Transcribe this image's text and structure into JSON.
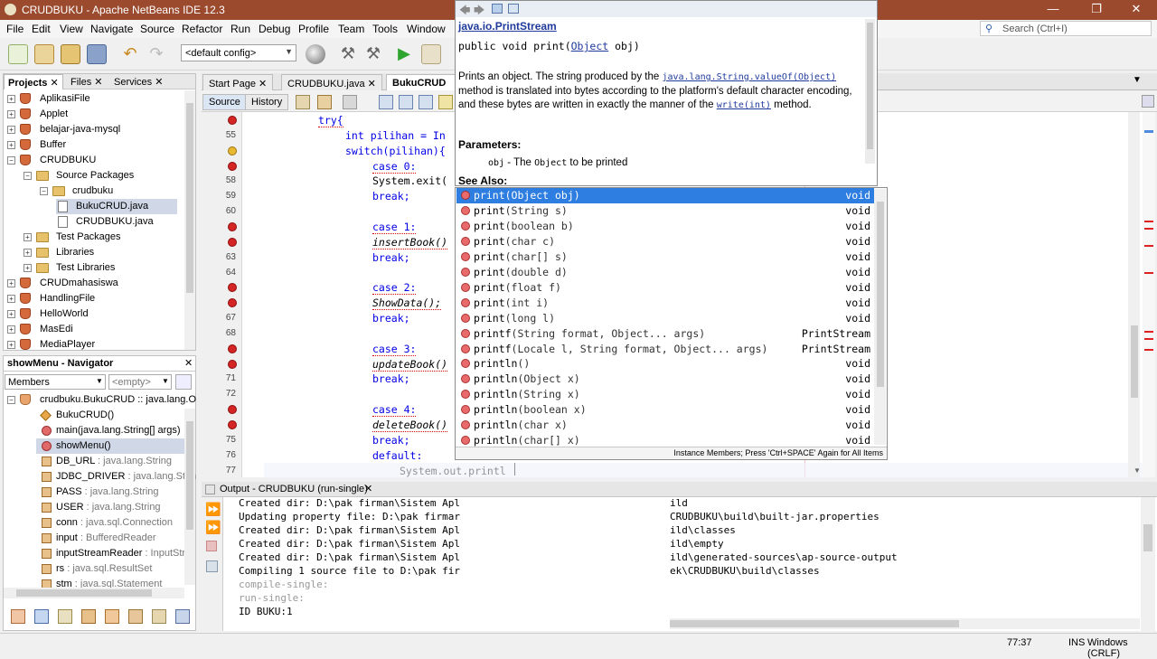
{
  "window": {
    "title": "CRUDBUKU - Apache NetBeans IDE 12.3",
    "min": "—",
    "max": "❐",
    "close": "✕"
  },
  "menu": [
    "File",
    "Edit",
    "View",
    "Navigate",
    "Source",
    "Refactor",
    "Run",
    "Debug",
    "Profile",
    "Team",
    "Tools",
    "Window"
  ],
  "search": {
    "placeholder": "Search (Ctrl+I)"
  },
  "toolbar": {
    "config": "<default config>"
  },
  "projects_panel": {
    "tabs": [
      "Projects",
      "Files",
      "Services"
    ],
    "items": [
      {
        "label": "AplikasiFile",
        "type": "project",
        "indent": 0
      },
      {
        "label": "Applet",
        "type": "project",
        "indent": 0
      },
      {
        "label": "belajar-java-mysql",
        "type": "project",
        "indent": 0
      },
      {
        "label": "Buffer",
        "type": "project",
        "indent": 0
      },
      {
        "label": "CRUDBUKU",
        "type": "project",
        "indent": 0
      },
      {
        "label": "Source Packages",
        "type": "folder",
        "indent": 1
      },
      {
        "label": "crudbuku",
        "type": "folder",
        "indent": 2
      },
      {
        "label": "BukuCRUD.java",
        "type": "file",
        "indent": 3,
        "selected": true
      },
      {
        "label": "CRUDBUKU.java",
        "type": "file",
        "indent": 3
      },
      {
        "label": "Test Packages",
        "type": "folder",
        "indent": 1
      },
      {
        "label": "Libraries",
        "type": "folder",
        "indent": 1
      },
      {
        "label": "Test Libraries",
        "type": "folder",
        "indent": 1
      },
      {
        "label": "CRUDmahasiswa",
        "type": "project",
        "indent": 0
      },
      {
        "label": "HandlingFile",
        "type": "project",
        "indent": 0
      },
      {
        "label": "HelloWorld",
        "type": "project",
        "indent": 0
      },
      {
        "label": "MasEdi",
        "type": "project",
        "indent": 0
      },
      {
        "label": "MediaPlayer",
        "type": "project",
        "indent": 0
      }
    ]
  },
  "navigator": {
    "title": "showMenu - Navigator",
    "members_label": "Members",
    "filter": "<empty>",
    "root": "crudbuku.BukuCRUD :: java.lang.O",
    "items": [
      {
        "label": "BukuCRUD()",
        "type": "",
        "kind": "ctor"
      },
      {
        "label": "main(java.lang.String[] args)",
        "type": "",
        "kind": "method"
      },
      {
        "label": "showMenu()",
        "type": "",
        "kind": "method",
        "selected": true
      },
      {
        "label": "DB_URL",
        "type": " : java.lang.String",
        "kind": "field"
      },
      {
        "label": "JDBC_DRIVER",
        "type": " : java.lang.Strin",
        "kind": "field"
      },
      {
        "label": "PASS",
        "type": " : java.lang.String",
        "kind": "field"
      },
      {
        "label": "USER",
        "type": " : java.lang.String",
        "kind": "field"
      },
      {
        "label": "conn",
        "type": " : java.sql.Connection",
        "kind": "field"
      },
      {
        "label": "input",
        "type": " : BufferedReader",
        "kind": "field"
      },
      {
        "label": "inputStreamReader",
        "type": " : InputStre",
        "kind": "field"
      },
      {
        "label": "rs",
        "type": " : java.sql.ResultSet",
        "kind": "field"
      },
      {
        "label": "stm",
        "type": " : java.sql.Statement",
        "kind": "field"
      }
    ]
  },
  "editor": {
    "tabs": [
      "Start Page",
      "CRUDBUKU.java",
      "BukuCRUD"
    ],
    "source_tab": "Source",
    "history_tab": "History",
    "lines": [
      {
        "n": "",
        "text": "try{",
        "indent": 84,
        "marker": "err",
        "kw": true
      },
      {
        "n": "55",
        "text": "int pilihan = In",
        "indent": 114,
        "marker": "",
        "kw": true
      },
      {
        "n": "",
        "text": "switch(pilihan){",
        "indent": 114,
        "marker": "warn",
        "kw": true
      },
      {
        "n": "",
        "text": "case 0:",
        "indent": 144,
        "marker": "err",
        "kw": true
      },
      {
        "n": "58",
        "text": "System.exit(",
        "indent": 144,
        "marker": ""
      },
      {
        "n": "59",
        "text": "break;",
        "indent": 144,
        "marker": "",
        "kw": true
      },
      {
        "n": "60",
        "text": "",
        "indent": 144,
        "marker": ""
      },
      {
        "n": "",
        "text": "case 1:",
        "indent": 144,
        "marker": "err",
        "kw": true
      },
      {
        "n": "",
        "text": "insertBook()",
        "indent": 144,
        "marker": "err",
        "it": true
      },
      {
        "n": "63",
        "text": "break;",
        "indent": 144,
        "marker": "",
        "kw": true
      },
      {
        "n": "64",
        "text": "",
        "indent": 144,
        "marker": ""
      },
      {
        "n": "",
        "text": "case 2:",
        "indent": 144,
        "marker": "err",
        "kw": true
      },
      {
        "n": "",
        "text": "ShowData();",
        "indent": 144,
        "marker": "err",
        "it": true
      },
      {
        "n": "67",
        "text": "break;",
        "indent": 144,
        "marker": "",
        "kw": true
      },
      {
        "n": "68",
        "text": "",
        "indent": 144,
        "marker": ""
      },
      {
        "n": "",
        "text": "case 3:",
        "indent": 144,
        "marker": "err",
        "kw": true
      },
      {
        "n": "",
        "text": "updateBook()",
        "indent": 144,
        "marker": "err",
        "it": true
      },
      {
        "n": "71",
        "text": "break;",
        "indent": 144,
        "marker": "",
        "kw": true
      },
      {
        "n": "72",
        "text": "",
        "indent": 144,
        "marker": ""
      },
      {
        "n": "",
        "text": "case 4:",
        "indent": 144,
        "marker": "err",
        "kw": true
      },
      {
        "n": "",
        "text": "deleteBook()",
        "indent": 144,
        "marker": "err",
        "it": true
      },
      {
        "n": "75",
        "text": "break;",
        "indent": 144,
        "marker": "",
        "kw": true
      },
      {
        "n": "76",
        "text": "default:",
        "indent": 144,
        "marker": "",
        "kw": true
      },
      {
        "n": "77",
        "text": "System.out.printl",
        "indent": 174,
        "marker": ""
      }
    ]
  },
  "javadoc": {
    "class": "java.io.PrintStream",
    "signature_pre": "public void print(",
    "signature_type": "Object",
    "signature_post": " obj)",
    "desc_1": "Prints an object. The string produced by the ",
    "desc_link1": "java.lang.String.valueOf(Object)",
    "desc_2": " method is translated into bytes according to the platform's default character encoding, and these bytes are written in exactly the manner of the ",
    "desc_link2": "write(int)",
    "desc_3": " method.",
    "params_heading": "Parameters:",
    "param_name": "obj",
    "param_text": " - The ",
    "param_type": "Object",
    "param_end": " to be printed",
    "see_also": "See Also:"
  },
  "completion": {
    "items": [
      {
        "name": "print",
        "args": "(Object obj)",
        "ret": "void"
      },
      {
        "name": "print",
        "args": "(String s)",
        "ret": "void"
      },
      {
        "name": "print",
        "args": "(boolean b)",
        "ret": "void"
      },
      {
        "name": "print",
        "args": "(char c)",
        "ret": "void"
      },
      {
        "name": "print",
        "args": "(char[] s)",
        "ret": "void"
      },
      {
        "name": "print",
        "args": "(double d)",
        "ret": "void"
      },
      {
        "name": "print",
        "args": "(float f)",
        "ret": "void"
      },
      {
        "name": "print",
        "args": "(int i)",
        "ret": "void"
      },
      {
        "name": "print",
        "args": "(long l)",
        "ret": "void"
      },
      {
        "name": "printf",
        "args": "(String format, Object... args)",
        "ret": "PrintStream"
      },
      {
        "name": "printf",
        "args": "(Locale l, String format, Object... args)",
        "ret": "PrintStream"
      },
      {
        "name": "println",
        "args": "()",
        "ret": "void"
      },
      {
        "name": "println",
        "args": "(Object x)",
        "ret": "void"
      },
      {
        "name": "println",
        "args": "(String x)",
        "ret": "void"
      },
      {
        "name": "println",
        "args": "(boolean x)",
        "ret": "void"
      },
      {
        "name": "println",
        "args": "(char x)",
        "ret": "void"
      },
      {
        "name": "println",
        "args": "(char[] x)",
        "ret": "void"
      }
    ],
    "footer": "Instance Members; Press 'Ctrl+SPACE' Again for All Items"
  },
  "output": {
    "title": "Output - CRUDBUKU (run-single)",
    "left": [
      "Created dir: D:\\pak firman\\Sistem Apl",
      "Updating property file: D:\\pak firmar",
      "Created dir: D:\\pak firman\\Sistem Apl",
      "Created dir: D:\\pak firman\\Sistem Apl",
      "Created dir: D:\\pak firman\\Sistem Apl",
      "Compiling 1 source file to D:\\pak fir",
      "compile-single:",
      "run-single:",
      "ID BUKU:1"
    ],
    "right": [
      "ild",
      "CRUDBUKU\\build\\built-jar.properties",
      "ild\\classes",
      "ild\\empty",
      "ild\\generated-sources\\ap-source-output",
      "ek\\CRUDBUKU\\build\\classes"
    ]
  },
  "status": {
    "position": "77:37",
    "mode": "INS",
    "eol": "Windows (CRLF)"
  }
}
